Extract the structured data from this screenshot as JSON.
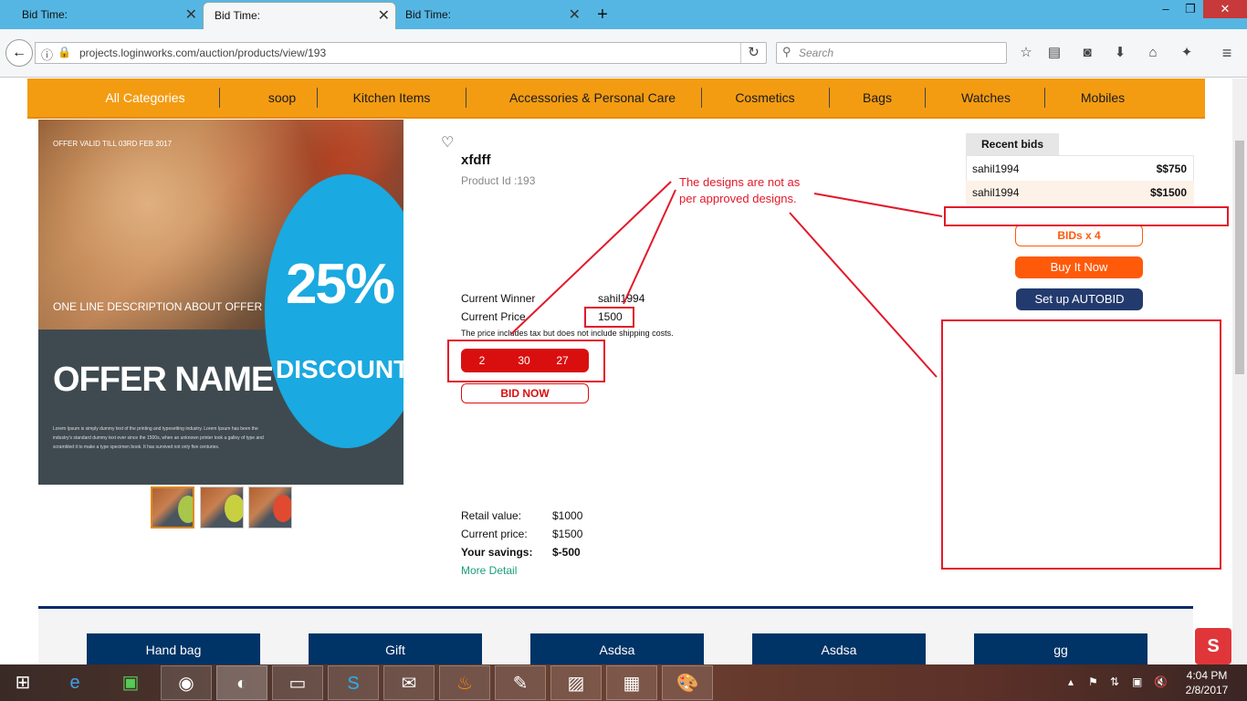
{
  "browser": {
    "tabs": [
      {
        "title": "Bid Time:"
      },
      {
        "title": "Bid Time:"
      },
      {
        "title": "Bid Time:"
      }
    ],
    "new_tab_label": "+",
    "url": "projects.loginworks.com/auction/products/view/193",
    "search_placeholder": "Search",
    "window_controls": [
      "–",
      "❐",
      "✕"
    ]
  },
  "site_nav": {
    "categories": [
      "All Categories",
      "soop",
      "Kitchen Items",
      "Accessories & Personal Care",
      "Cosmetics",
      "Bags",
      "Watches",
      "Mobiles"
    ]
  },
  "offer_image": {
    "valid_text": "OFFER VALID TILL 03RD FEB 2017",
    "description": "ONE LINE DESCRIPTION ABOUT OFFER",
    "name": "OFFER NAME",
    "percent": "25%",
    "discount": "DISCOUNT",
    "body": "Lorem Ipsum is simply dummy text of the printing and typesetting industry. Lorem Ipsum has been the industry's standard dummy text ever since the 1500s, when an unknown printer took a galley of type and scrambled it to make a type specimen book. It has survived not only five centuries."
  },
  "product": {
    "title": "xfdff",
    "product_id": "Product Id :193",
    "winner_label": "Current Winner",
    "winner_value": "sahil1994",
    "price_label": "Current Price",
    "price_value": "1500",
    "tax_note": "The price includes tax but does not include shipping costs.",
    "timer": [
      "2",
      "30",
      "27"
    ],
    "bid_now": "BID NOW",
    "retail_label": "Retail value:",
    "retail_value": "$1000",
    "current_label": "Current price:",
    "current_value": "$1500",
    "savings_label": "Your savings:",
    "savings_value": "$-500",
    "more_detail": "More Detail"
  },
  "recent_bids": {
    "header": "Recent bids",
    "rows": [
      {
        "user": "sahil1994",
        "amount": "$$750"
      },
      {
        "user": "sahil1994",
        "amount": "$$1500"
      }
    ],
    "bids_button": "BIDs x 4",
    "buy_now": "Buy It Now",
    "autobid": "Set up AUTOBID"
  },
  "annotation": {
    "line1": "The designs are not as",
    "line2": "per approved designs."
  },
  "footer_categories": [
    "Hand bag",
    "Gift",
    "Asdsa",
    "Asdsa",
    "gg"
  ],
  "taskbar": {
    "time": "4:04 PM",
    "date": "2/8/2017"
  },
  "colors": {
    "tab_strip": "#56b6e3",
    "nav_orange": "#f39c12",
    "timer_red": "#d90f0f",
    "buy_now_orange": "#ff5a0a",
    "autobid_navy": "#233a6e",
    "annotation_red": "#e3192a",
    "footer_navy": "#003366"
  }
}
